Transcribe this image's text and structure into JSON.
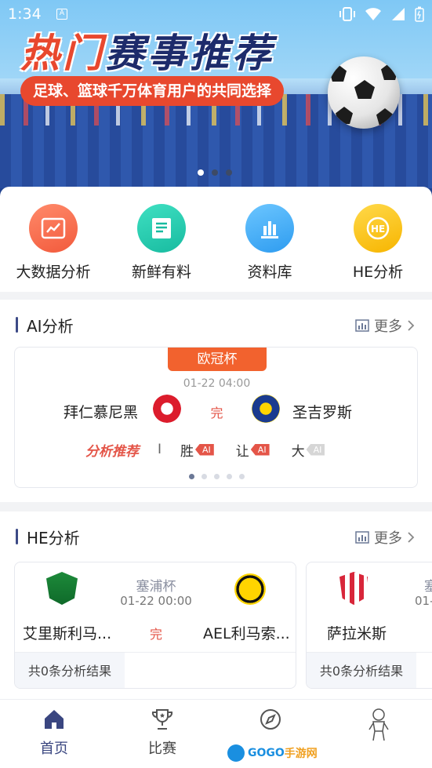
{
  "status_bar": {
    "time": "1:34",
    "badge": "A"
  },
  "banner": {
    "title_part1": "热门",
    "title_part2": "赛事推荐",
    "subtitle": "足球、篮球千万体育用户的共同选择",
    "page_count": 3,
    "active_page": 1
  },
  "quick_menu": [
    {
      "label": "大数据分析",
      "icon": "bar-chart-icon"
    },
    {
      "label": "新鲜有料",
      "icon": "document-icon"
    },
    {
      "label": "资料库",
      "icon": "bars-icon"
    },
    {
      "label": "HE分析",
      "icon": "he-icon"
    }
  ],
  "ai_section": {
    "title": "AI分析",
    "more": "更多",
    "match": {
      "competition": "欧冠杯",
      "time": "01-22 04:00",
      "home": "拜仁慕尼黑",
      "away": "圣吉罗斯",
      "status": "完",
      "recommend_label": "分析推荐",
      "separator": "I",
      "picks": [
        {
          "label": "胜",
          "tag": "AI"
        },
        {
          "label": "让",
          "tag": "AI"
        },
        {
          "label": "大",
          "tag": "AI"
        }
      ]
    },
    "carousel_pages": 5,
    "carousel_active": 1
  },
  "he_section": {
    "title": "HE分析",
    "more": "更多",
    "cards": [
      {
        "competition": "塞浦杯",
        "time": "01-22 00:00",
        "home": "艾里斯利马...",
        "away": "AEL利马索...",
        "status": "完",
        "result": "共0条分析结果"
      },
      {
        "competition": "塞",
        "time": "01-",
        "home": "萨拉米斯",
        "result": "共0条分析结果"
      }
    ]
  },
  "bottom_nav": [
    {
      "label": "首页",
      "icon": "home-icon",
      "active": true
    },
    {
      "label": "比赛",
      "icon": "trophy-icon",
      "active": false
    },
    {
      "label": "",
      "icon": "compass-icon",
      "active": false
    },
    {
      "label": "",
      "icon": "profile-icon",
      "active": false
    }
  ],
  "watermark": {
    "text_part1": "GOGO",
    "text_part2": "手游网",
    "url": "WWW.GOGO.CN"
  },
  "colors": {
    "accent": "#e45548",
    "nav_active": "#3a4680",
    "cup_badge": "#f2622e"
  }
}
